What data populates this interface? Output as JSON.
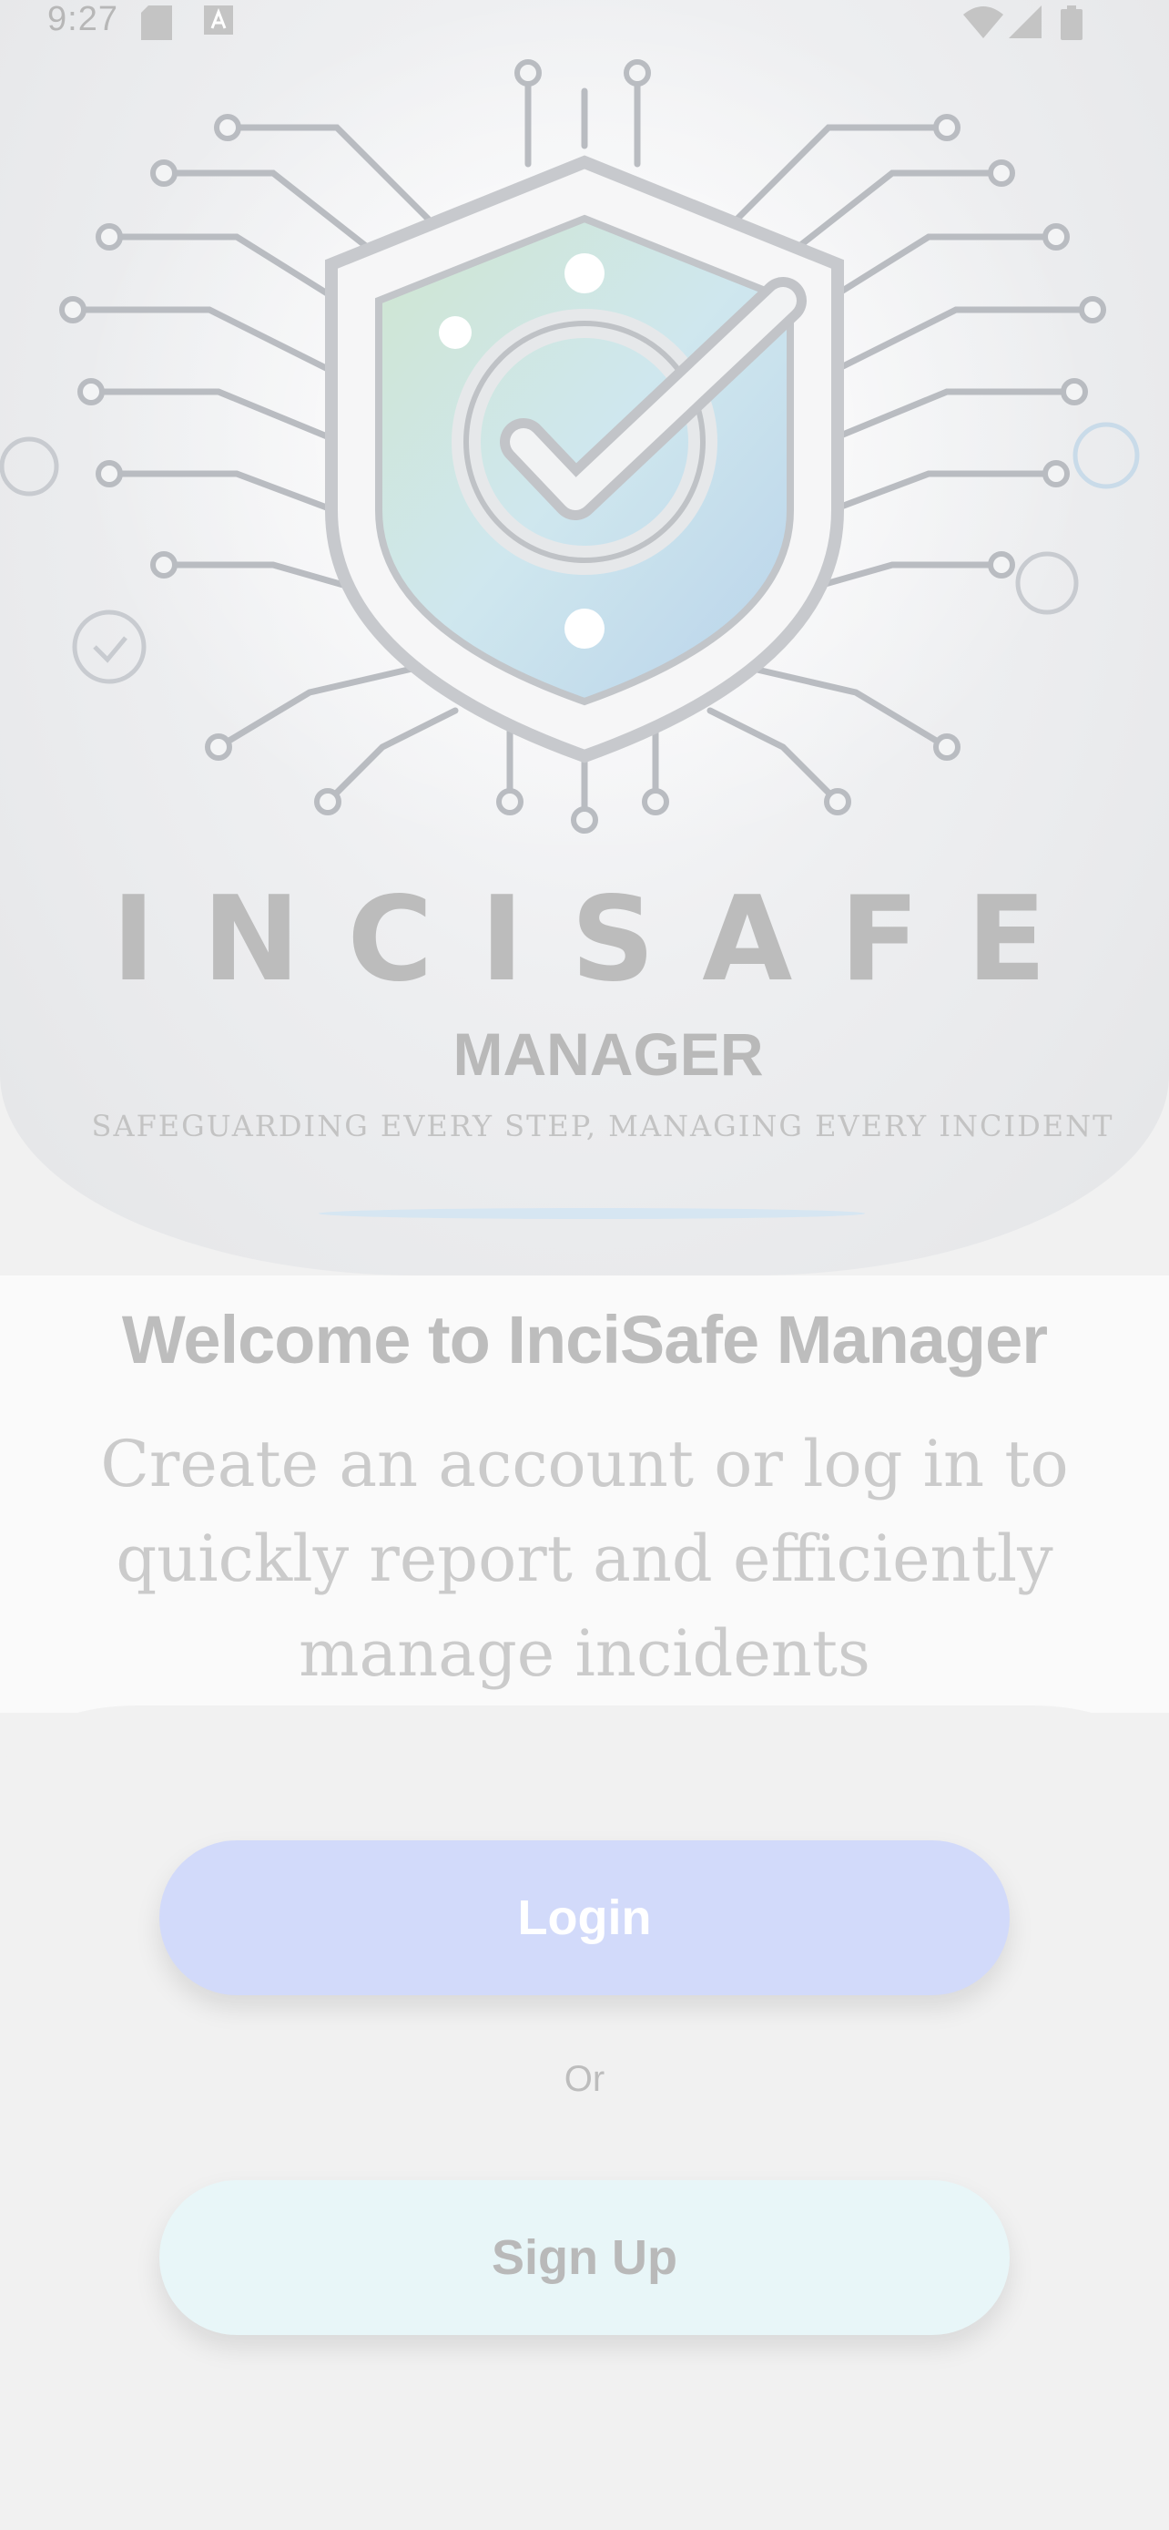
{
  "status_bar": {
    "time": "9:27",
    "icons": [
      "sd-card-icon",
      "keyboard-a-icon",
      "wifi-icon",
      "signal-icon",
      "battery-icon"
    ]
  },
  "hero": {
    "logo_word": "INCISAFE",
    "logo_sub": "MANAGER",
    "tagline": "SAFEGUARDING EVERY STEP, MANAGING EVERY INCIDENT",
    "icon": "shield-check-icon"
  },
  "welcome": {
    "title": "Welcome to InciSafe Manager",
    "subtitle": "Create an account or log in to quickly report and efficiently manage incidents"
  },
  "actions": {
    "login_label": "Login",
    "or_label": "Or",
    "signup_label": "Sign Up"
  },
  "colors": {
    "login_bg": "#d2dafa",
    "signup_bg": "#e8f6f8",
    "panel_bg": "#f1f1f1"
  }
}
